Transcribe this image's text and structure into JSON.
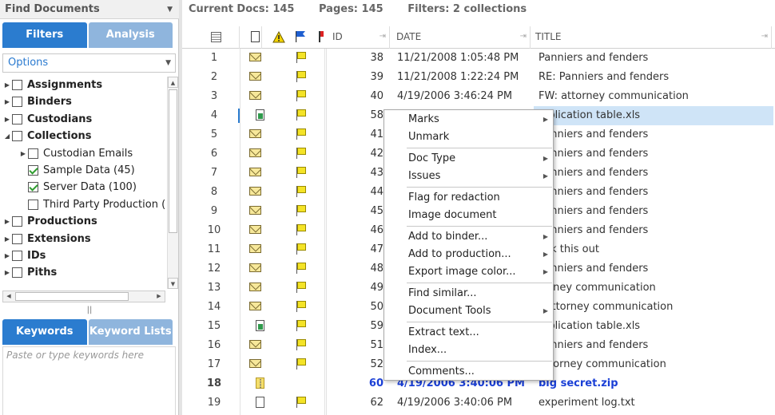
{
  "left_panel": {
    "title": "Find Documents",
    "tabs": [
      "Filters",
      "Analysis"
    ],
    "options_label": "Options",
    "tree": [
      {
        "label": "Assignments",
        "bold": true,
        "checked": false,
        "expand": true,
        "indent": 0
      },
      {
        "label": "Binders",
        "bold": true,
        "checked": false,
        "expand": true,
        "indent": 0
      },
      {
        "label": "Custodians",
        "bold": true,
        "checked": false,
        "expand": true,
        "indent": 0
      },
      {
        "label": "Collections",
        "bold": true,
        "checked": false,
        "expand": true,
        "expanded": true,
        "indent": 0
      },
      {
        "label": "Custodian Emails",
        "bold": false,
        "checked": false,
        "expand": true,
        "indent": 1
      },
      {
        "label": "Sample Data (45)",
        "bold": false,
        "checked": true,
        "expand": false,
        "indent": 1
      },
      {
        "label": "Server Data (100)",
        "bold": false,
        "checked": true,
        "expand": false,
        "indent": 1
      },
      {
        "label": "Third Party Production (",
        "bold": false,
        "checked": false,
        "expand": false,
        "indent": 1
      },
      {
        "label": "Productions",
        "bold": true,
        "checked": false,
        "expand": true,
        "indent": 0
      },
      {
        "label": "Extensions",
        "bold": true,
        "checked": false,
        "expand": true,
        "indent": 0
      },
      {
        "label": "IDs",
        "bold": true,
        "checked": false,
        "expand": true,
        "indent": 0
      },
      {
        "label": "Piths",
        "bold": true,
        "checked": false,
        "expand": true,
        "indent": 0
      }
    ],
    "keyword_tabs": [
      "Keywords",
      "Keyword Lists"
    ],
    "keyword_placeholder": "Paste or type keywords here"
  },
  "summary": {
    "current_docs": "Current Docs: 145",
    "pages": "Pages: 145",
    "filters": "Filters: 2 collections"
  },
  "grid": {
    "headers": {
      "id": "ID",
      "date": "DATE",
      "title": "TITLE"
    },
    "rows": [
      {
        "n": "1",
        "icon": "envelope-icon",
        "flag": true,
        "id": "38",
        "date": "11/21/2008 1:05:48 PM",
        "title": "Panniers and fenders"
      },
      {
        "n": "2",
        "icon": "envelope-icon",
        "flag": true,
        "id": "39",
        "date": "11/21/2008 1:22:24 PM",
        "title": "RE: Panniers and fenders"
      },
      {
        "n": "3",
        "icon": "envelope-icon",
        "flag": true,
        "id": "40",
        "date": "4/19/2006 3:46:24 PM",
        "title": "FW: attorney communication"
      },
      {
        "n": "4",
        "icon": "spreadsheet-icon",
        "flag": true,
        "id": "58",
        "date": "",
        "title": "ltiplication table.xls",
        "selected": true,
        "focus": true
      },
      {
        "n": "5",
        "icon": "envelope-icon",
        "flag": true,
        "id": "41",
        "date": "",
        "title": "Panniers and fenders"
      },
      {
        "n": "6",
        "icon": "envelope-icon",
        "flag": true,
        "id": "42",
        "date": "",
        "title": "Panniers and fenders"
      },
      {
        "n": "7",
        "icon": "envelope-icon",
        "flag": true,
        "id": "43",
        "date": "",
        "title": "Panniers and fenders"
      },
      {
        "n": "8",
        "icon": "envelope-icon",
        "flag": true,
        "id": "44",
        "date": "",
        "title": "Panniers and fenders"
      },
      {
        "n": "9",
        "icon": "envelope-icon",
        "flag": true,
        "id": "45",
        "date": "",
        "title": "Panniers and fenders"
      },
      {
        "n": "10",
        "icon": "envelope-icon",
        "flag": true,
        "id": "46",
        "date": "",
        "title": "Panniers and fenders"
      },
      {
        "n": "11",
        "icon": "envelope-icon",
        "flag": true,
        "id": "47",
        "date": "",
        "title": "eck this out"
      },
      {
        "n": "12",
        "icon": "envelope-icon",
        "flag": true,
        "id": "48",
        "date": "",
        "title": "Panniers and fenders"
      },
      {
        "n": "13",
        "icon": "envelope-icon",
        "flag": true,
        "id": "49",
        "date": "",
        "title": "torney communication"
      },
      {
        "n": "14",
        "icon": "envelope-icon",
        "flag": true,
        "id": "50",
        "date": "",
        "title": ": attorney communication"
      },
      {
        "n": "15",
        "icon": "spreadsheet-icon",
        "flag": true,
        "id": "59",
        "date": "",
        "title": "ltiplication table.xls"
      },
      {
        "n": "16",
        "icon": "envelope-icon",
        "flag": true,
        "id": "51",
        "date": "",
        "title": "Panniers and fenders"
      },
      {
        "n": "17",
        "icon": "envelope-icon",
        "flag": true,
        "id": "52",
        "date": "",
        "title": "attorney communication"
      },
      {
        "n": "18",
        "icon": "zip-icon",
        "flag": false,
        "id": "60",
        "date": "4/19/2006 3:40:06 PM",
        "title": "big secret.zip",
        "bold": true
      },
      {
        "n": "19",
        "icon": "blank-doc-icon",
        "flag": true,
        "id": "62",
        "date": "4/19/2006 3:40:06 PM",
        "title": "experiment log.txt"
      }
    ]
  },
  "context_menu": {
    "items": [
      {
        "label": "Marks",
        "sub": true
      },
      {
        "label": "Unmark",
        "sub": false,
        "sep_after": true
      },
      {
        "label": "Doc Type",
        "sub": true
      },
      {
        "label": "Issues",
        "sub": true,
        "sep_after": true
      },
      {
        "label": "Flag for redaction",
        "sub": false
      },
      {
        "label": "Image document",
        "sub": false,
        "sep_after": true
      },
      {
        "label": "Add to binder...",
        "sub": true
      },
      {
        "label": "Add to production...",
        "sub": true
      },
      {
        "label": "Export image color...",
        "sub": true,
        "sep_after": true
      },
      {
        "label": "Find similar...",
        "sub": false
      },
      {
        "label": "Document Tools",
        "sub": true,
        "sep_after": true
      },
      {
        "label": "Extract text...",
        "sub": false
      },
      {
        "label": "Index...",
        "sub": false,
        "sep_after": true
      },
      {
        "label": "Comments...",
        "sub": false
      }
    ]
  },
  "colors": {
    "accent": "#2b7ccf",
    "tab_inactive": "#8fb5dd",
    "selection": "#cfe4f7",
    "bold_link": "#1a3fd6"
  }
}
